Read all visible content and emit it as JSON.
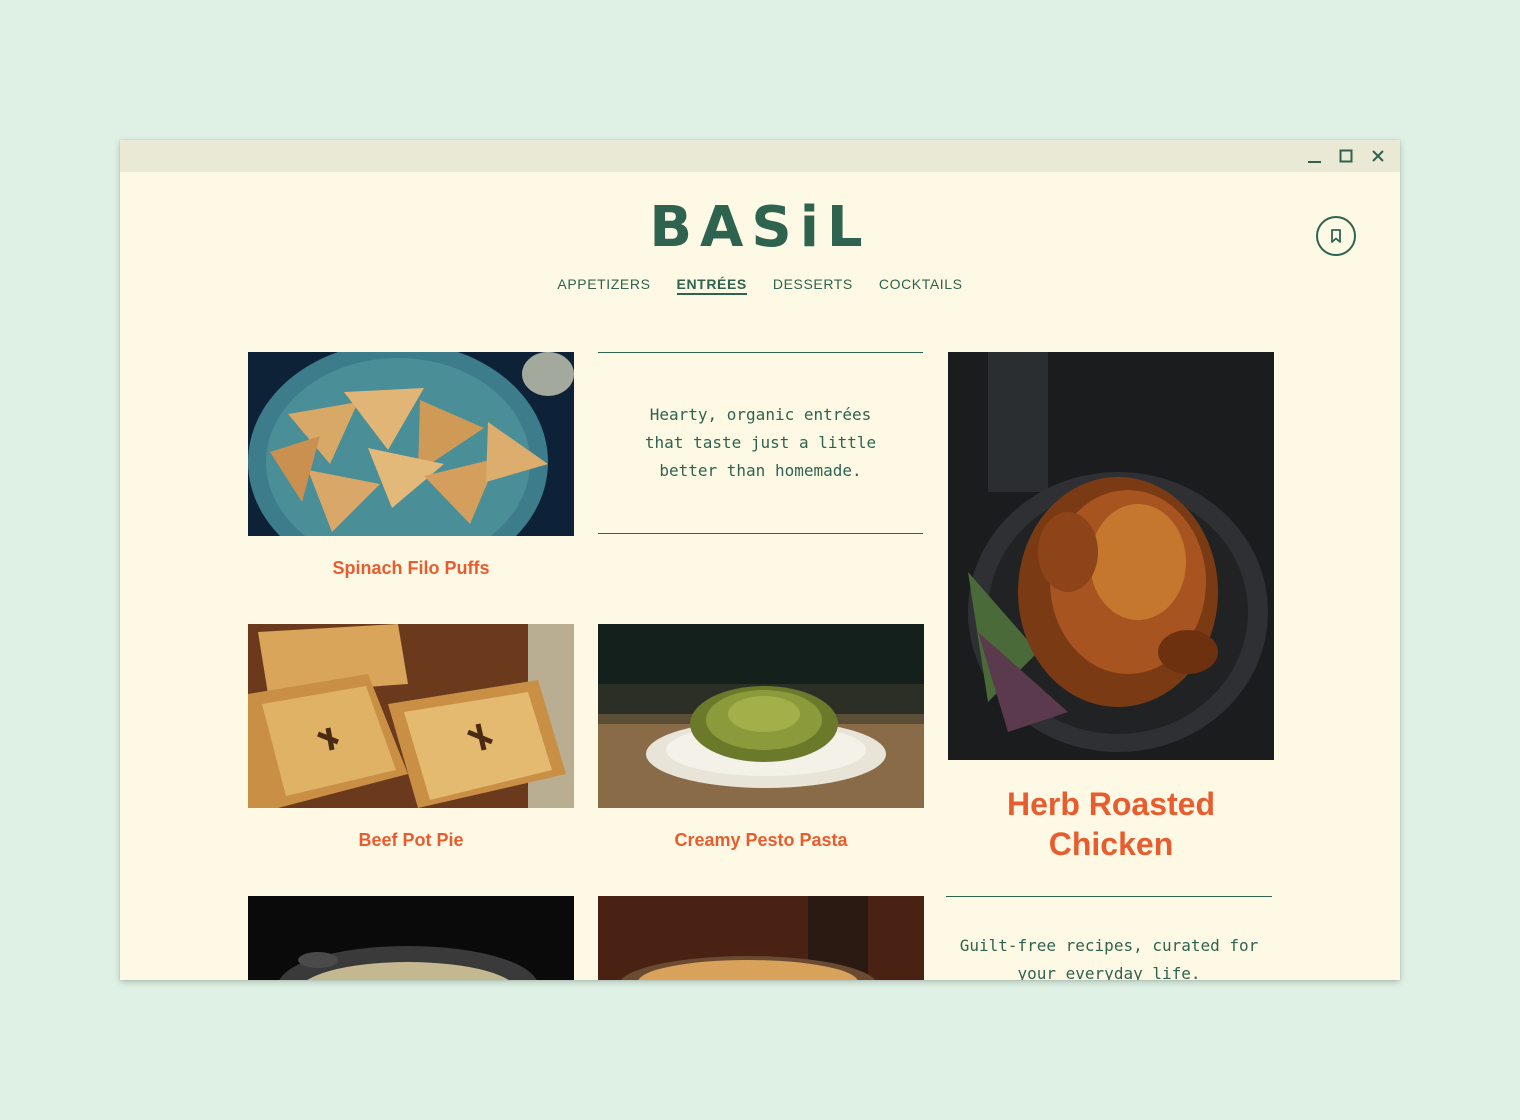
{
  "window": {
    "controls": {
      "minimize": "minimize",
      "maximize": "maximize",
      "close": "close"
    }
  },
  "brand": {
    "logo": "BASiL"
  },
  "nav": {
    "items": [
      {
        "label": "APPETIZERS",
        "active": false
      },
      {
        "label": "ENTRÉES",
        "active": true
      },
      {
        "label": "DESSERTS",
        "active": false
      },
      {
        "label": "COCKTAILS",
        "active": false
      }
    ]
  },
  "intro": {
    "tagline": "Hearty, organic entrées that taste just a little better than homemade."
  },
  "cards": [
    {
      "title": "Spinach Filo Puffs",
      "image": "spinach-filo-puffs-photo"
    },
    {
      "title": "Beef Pot Pie",
      "image": "beef-pot-pie-photo"
    },
    {
      "title": "Creamy Pesto Pasta",
      "image": "creamy-pesto-pasta-photo"
    },
    {
      "title": "",
      "image": "soup-pot-photo"
    },
    {
      "title": "",
      "image": "pie-dish-photo"
    }
  ],
  "feature": {
    "title": "Herb Roasted Chicken",
    "image": "herb-roasted-chicken-photo",
    "tagline": "Guilt-free recipes, curated for your everyday life."
  },
  "icons": {
    "bookmark": "bookmark-icon"
  },
  "colors": {
    "background": "#dff1e5",
    "page": "#fef9e4",
    "brand": "#2e6350",
    "accent": "#e85d2f"
  }
}
